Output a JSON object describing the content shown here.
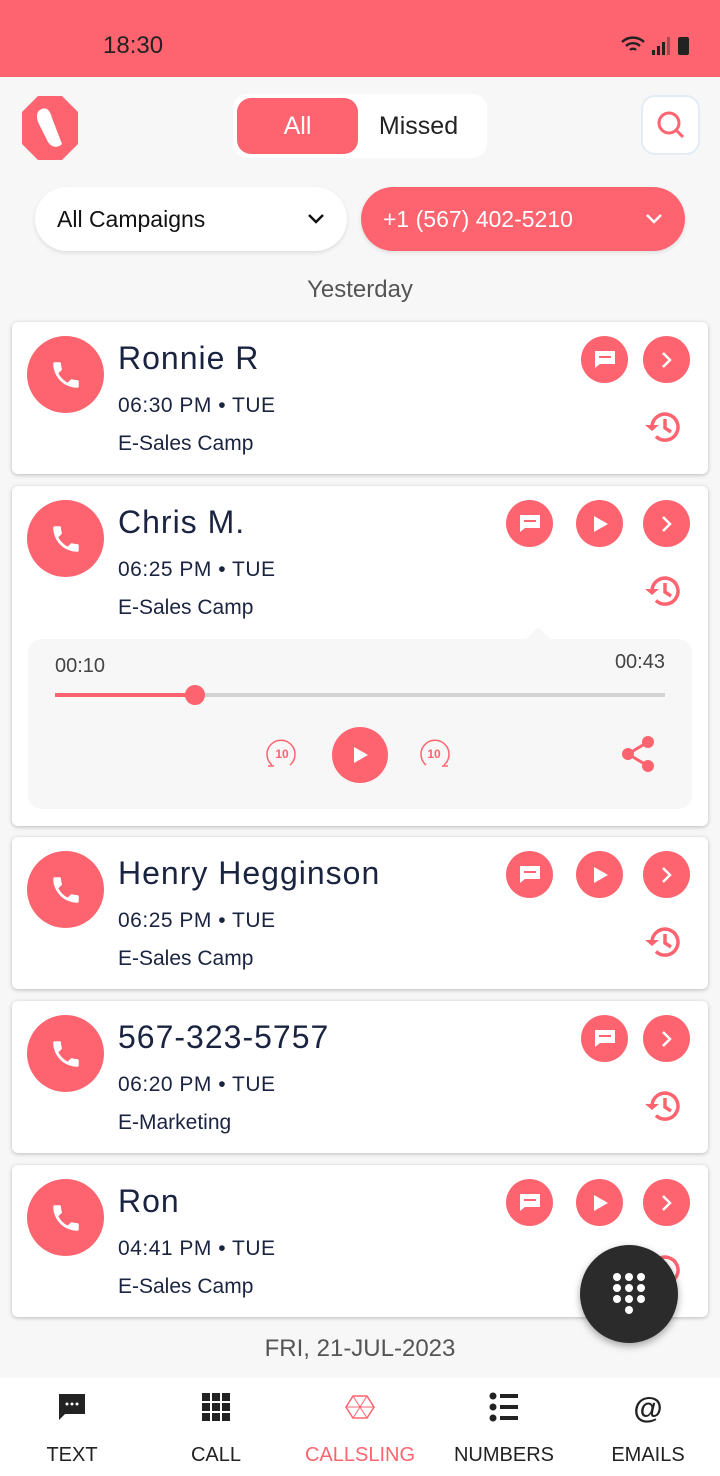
{
  "status_bar": {
    "time": "18:30",
    "icons": [
      "wifi-icon",
      "signal-icon",
      "battery-charging-icon"
    ]
  },
  "header": {
    "tabs": [
      {
        "label": "All",
        "active": true
      },
      {
        "label": "Missed",
        "active": false
      }
    ],
    "search_icon": "search-icon"
  },
  "filters": {
    "campaign": "All Campaigns",
    "number": "+1 (567) 402-5210"
  },
  "sections": {
    "yesterday": "Yesterday",
    "next": "FRI, 21-JUL-2023"
  },
  "calls": [
    {
      "name": "Ronnie R",
      "time": "06:30 PM • TUE",
      "campaign": "E-Sales Camp",
      "has_recording": false
    },
    {
      "name": "Chris M.",
      "time": "06:25 PM • TUE",
      "campaign": "E-Sales Camp",
      "has_recording": true,
      "expanded": true
    },
    {
      "name": "Henry Hegginson",
      "time": "06:25 PM • TUE",
      "campaign": "E-Sales Camp",
      "has_recording": true
    },
    {
      "name": "567-323-5757",
      "time": "06:20 PM • TUE",
      "campaign": "E-Marketing",
      "has_recording": false
    },
    {
      "name": "Ron",
      "time": "04:41 PM • TUE",
      "campaign": "E-Sales Camp",
      "has_recording": true
    }
  ],
  "player": {
    "current": "00:10",
    "duration": "00:43",
    "progress_fraction": 0.23
  },
  "nav": [
    {
      "label": "TEXT",
      "icon": "message-icon"
    },
    {
      "label": "CALL",
      "icon": "dialpad-icon"
    },
    {
      "label": "CALLSLING",
      "icon": "callsling-icon",
      "active": true
    },
    {
      "label": "NUMBERS",
      "icon": "list-icon"
    },
    {
      "label": "EMAILS",
      "icon": "at-icon"
    }
  ],
  "colors": {
    "accent": "#fe646f",
    "text": "#1a2340",
    "fab": "#2b2b2b"
  }
}
